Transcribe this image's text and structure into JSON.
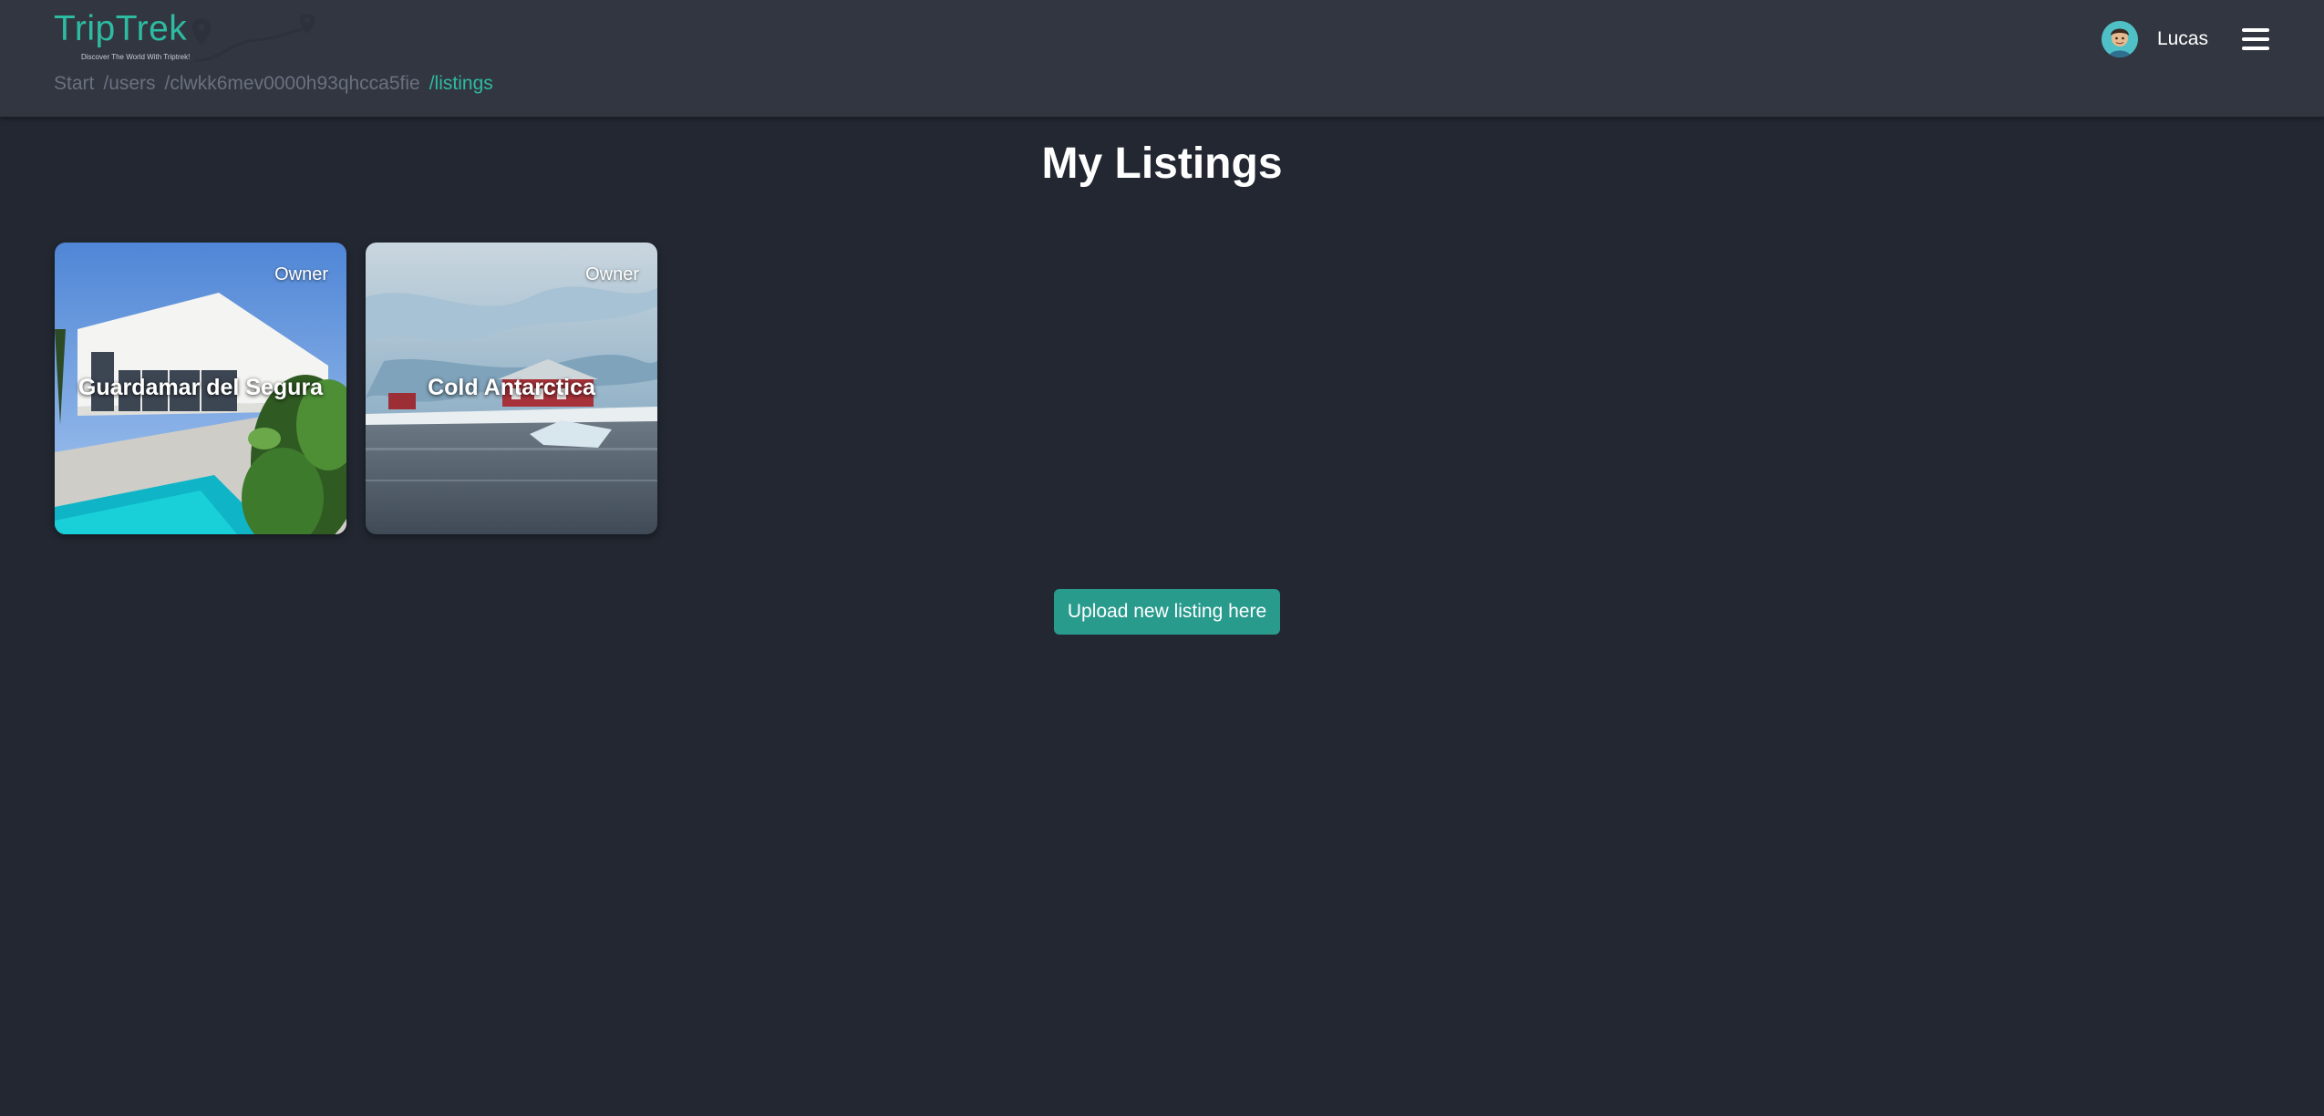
{
  "navbar": {
    "logo": {
      "title": "TripTrek",
      "tagline": "Discover The World With Triptrek!"
    },
    "breadcrumb": [
      "Start",
      "/users",
      "/clwkk6mev0000h93qhcca5fie",
      "/listings"
    ],
    "user": {
      "name": "Lucas"
    },
    "icons": {
      "avatar": "user-avatar",
      "menu": "hamburger-icon"
    }
  },
  "main": {
    "title": "My Listings",
    "listings": [
      {
        "title": "Guardamar del Segura",
        "badge": "Owner"
      },
      {
        "title": "Cold Antarctica",
        "badge": "Owner"
      }
    ],
    "upload_label": "Upload new listing here"
  },
  "colors": {
    "background": "#222731",
    "navbar": "#323640",
    "accent": "#2dbba2",
    "button": "#299b8d"
  }
}
